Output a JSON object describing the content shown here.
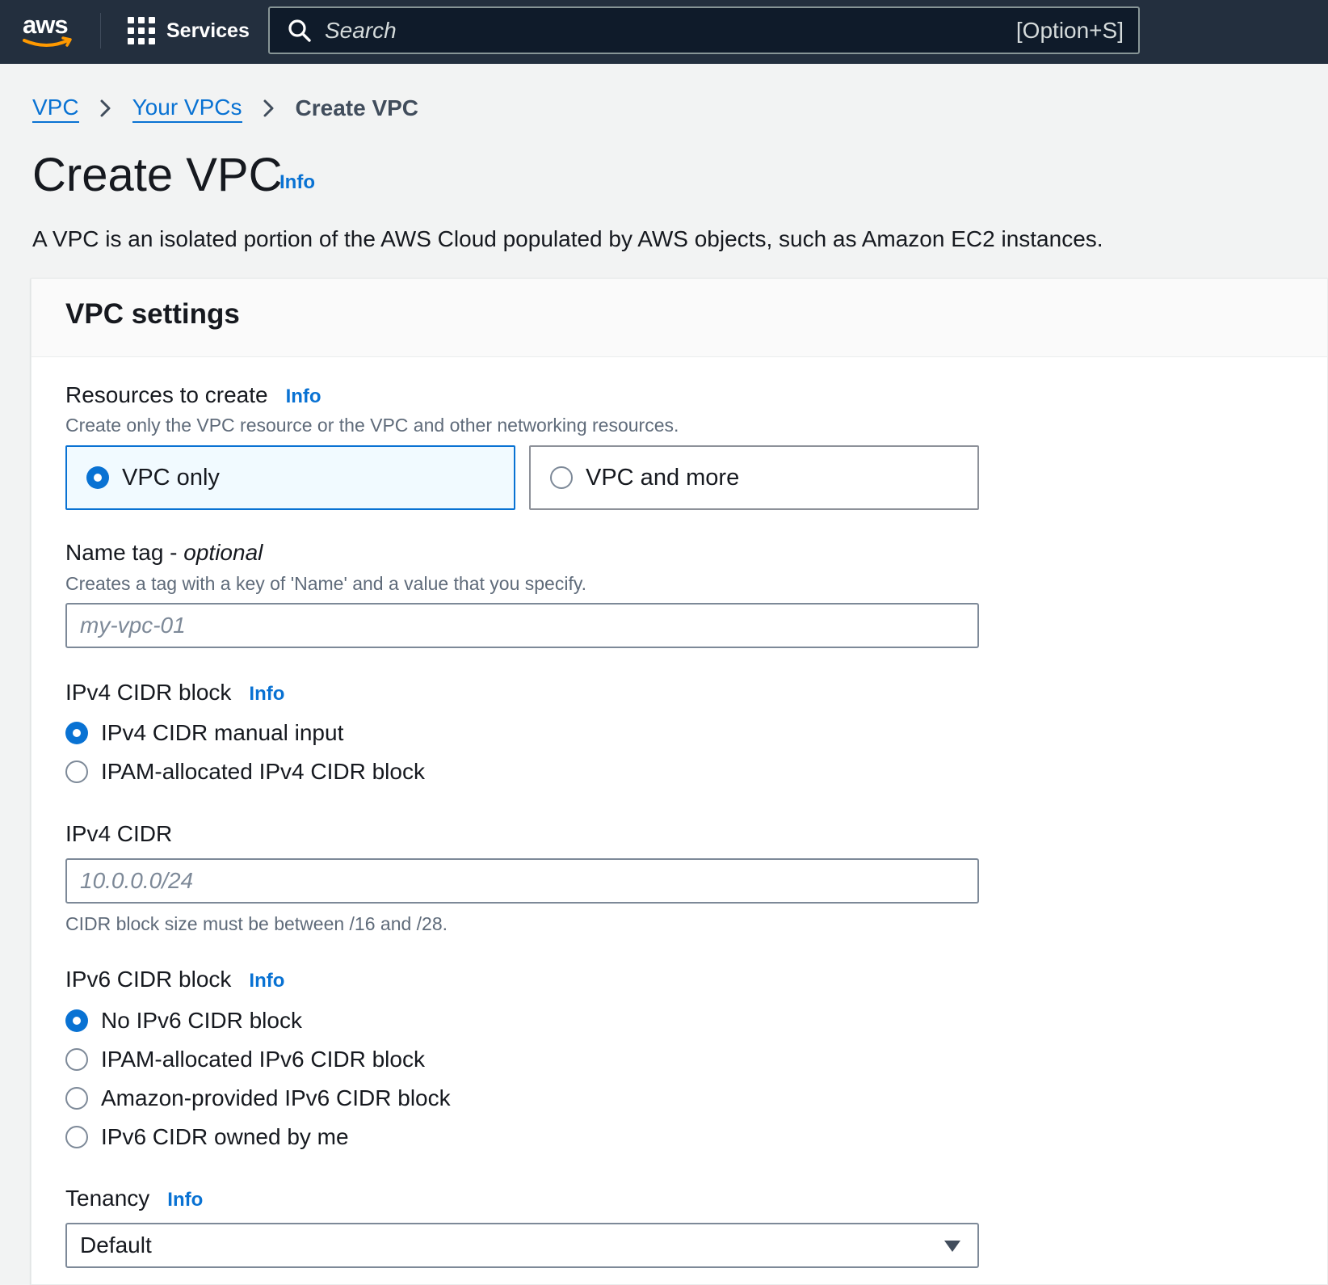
{
  "topnav": {
    "logo_text": "aws",
    "services_label": "Services",
    "search_placeholder": "Search",
    "search_shortcut": "[Option+S]"
  },
  "breadcrumb": {
    "items": [
      "VPC",
      "Your VPCs"
    ],
    "current": "Create VPC"
  },
  "page": {
    "title": "Create VPC",
    "info": "Info",
    "description": "A VPC is an isolated portion of the AWS Cloud populated by AWS objects, such as Amazon EC2 instances."
  },
  "panel": {
    "title": "VPC settings",
    "resources": {
      "label": "Resources to create",
      "info": "Info",
      "description": "Create only the VPC resource or the VPC and other networking resources.",
      "options": [
        "VPC only",
        "VPC and more"
      ],
      "selected": "VPC only"
    },
    "name_tag": {
      "label": "Name tag - ",
      "label_optional": "optional",
      "description": "Creates a tag with a key of 'Name' and a value that you specify.",
      "placeholder": "my-vpc-01"
    },
    "ipv4_block": {
      "label": "IPv4 CIDR block",
      "info": "Info",
      "options": [
        "IPv4 CIDR manual input",
        "IPAM-allocated IPv4 CIDR block"
      ],
      "selected": "IPv4 CIDR manual input"
    },
    "ipv4_cidr": {
      "label": "IPv4 CIDR",
      "placeholder": "10.0.0.0/24",
      "constraint": "CIDR block size must be between /16 and /28."
    },
    "ipv6_block": {
      "label": "IPv6 CIDR block",
      "info": "Info",
      "options": [
        "No IPv6 CIDR block",
        "IPAM-allocated IPv6 CIDR block",
        "Amazon-provided IPv6 CIDR block",
        "IPv6 CIDR owned by me"
      ],
      "selected": "No IPv6 CIDR block"
    },
    "tenancy": {
      "label": "Tenancy",
      "info": "Info",
      "value": "Default"
    }
  },
  "colors": {
    "nav_bg": "#232f3e",
    "link": "#0972d3",
    "aws_orange": "#ff9900"
  },
  "icons": [
    "aws-logo",
    "services-grid-icon",
    "search-icon",
    "chevron-right-icon",
    "caret-down-icon"
  ]
}
